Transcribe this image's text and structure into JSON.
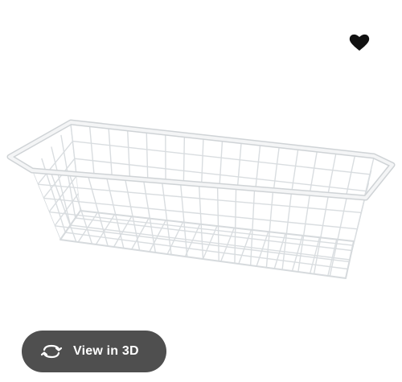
{
  "product": {
    "image_alt": "wire-basket-image"
  },
  "favorite": {
    "icon": "heart-icon",
    "color": "#111111"
  },
  "view3d": {
    "label": "View in 3D",
    "icon": "rotate-3d-icon",
    "background": "#4f4f4f",
    "text_color": "#ffffff"
  }
}
